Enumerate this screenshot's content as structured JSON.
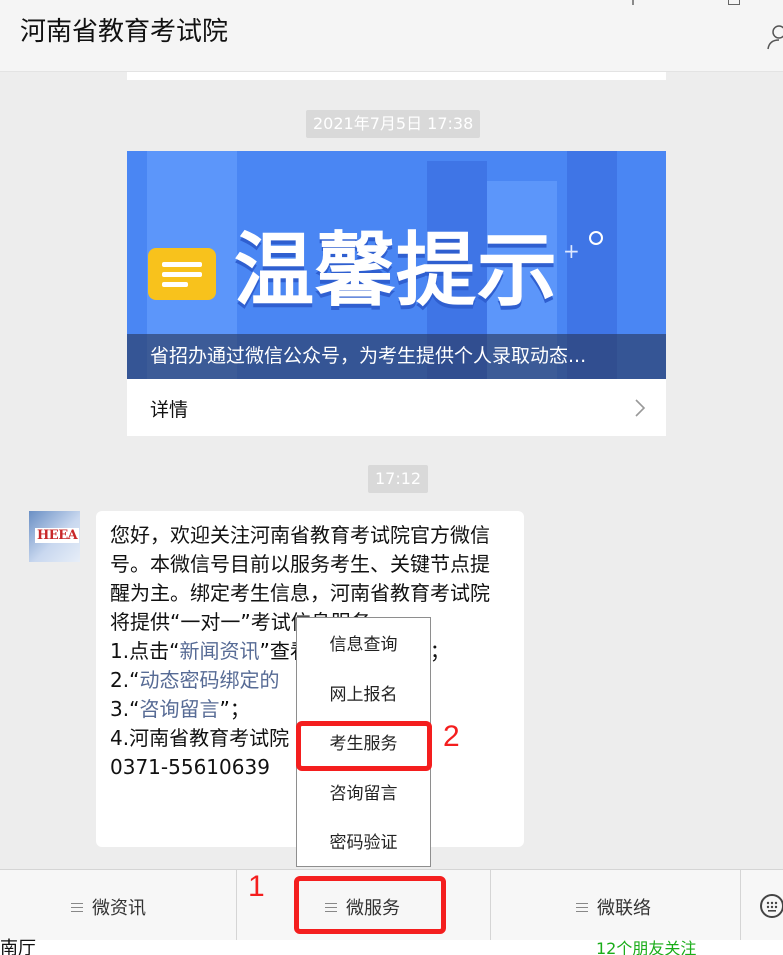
{
  "header": {
    "title": "河南省教育考试院"
  },
  "timestamps": [
    "2021年7月5日 17:38",
    "17:12"
  ],
  "article": {
    "headline": "温馨提示",
    "caption": "省招办通过微信公众号，为考生提供个人录取动态...",
    "detail_label": "详情"
  },
  "avatar": {
    "logo_text": "HEEA"
  },
  "message": {
    "line1": "您好，欢迎关注河南省教育考试院官方微信",
    "line2": "号。本微信号目前以服务考生、关键节点提",
    "line3": "醒为主。绑定考生信息，河南省教育考试院",
    "line4": "将提供“一对一”考试信息服务。",
    "line5_prefix": "1.点击“",
    "line5_link": "新闻资讯",
    "line5_suffix": "”查看最新考试动态；",
    "line6_prefix": "2.“",
    "line6_link": "动态密码绑定的",
    "line7_prefix": "3.“",
    "line7_link": "咨询留言",
    "line7_suffix": "”；",
    "line8": "4.河南省教育考试院",
    "line9": "0371-55610639"
  },
  "popup_menu": {
    "items": [
      "信息查询",
      "网上报名",
      "考生服务",
      "咨询留言",
      "密码验证"
    ]
  },
  "annotations": {
    "step1": "1",
    "step2": "2",
    "highlight_color": "#f41e1e"
  },
  "bottom_menu": {
    "tabs": [
      "微资讯",
      "微服务",
      "微联络"
    ]
  },
  "underlay": {
    "left_text": "南厅",
    "right_text": "12个朋友关注"
  }
}
